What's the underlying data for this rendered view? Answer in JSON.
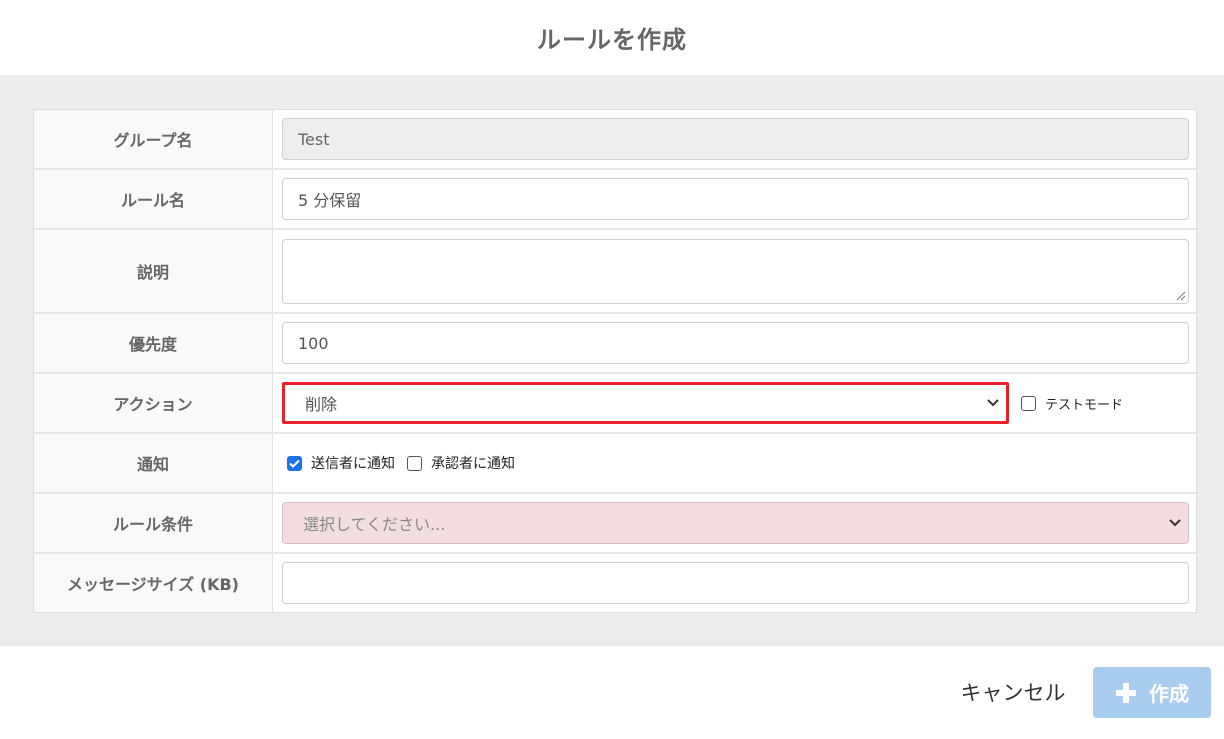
{
  "dialog": {
    "title": "ルールを作成"
  },
  "form": {
    "group_name": {
      "label": "グループ名",
      "value": "Test"
    },
    "rule_name": {
      "label": "ルール名",
      "value": "5 分保留"
    },
    "description": {
      "label": "説明",
      "value": ""
    },
    "priority": {
      "label": "優先度",
      "value": "100"
    },
    "action": {
      "label": "アクション",
      "value": "削除",
      "test_mode_label": "テストモード",
      "test_mode_checked": false
    },
    "notify": {
      "label": "通知",
      "options": [
        {
          "label": "送信者に通知",
          "checked": true
        },
        {
          "label": "承認者に通知",
          "checked": false
        }
      ]
    },
    "rule_condition": {
      "label": "ルール条件",
      "placeholder": "選択してください..."
    },
    "message_size": {
      "label": "メッセージサイズ (KB)",
      "value": ""
    }
  },
  "footer": {
    "cancel_label": "キャンセル",
    "create_label": "作成"
  },
  "colors": {
    "highlight": "#e8202a",
    "primary_disabled": "#a8cdf0",
    "error_bg": "#f2dede"
  }
}
